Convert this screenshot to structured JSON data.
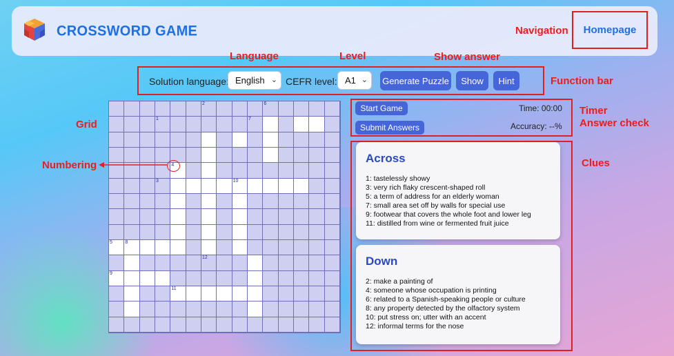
{
  "header": {
    "title": "CROSSWORD GAME",
    "home_link": "Homepage"
  },
  "annotations": {
    "navigation": "Navigation",
    "language": "Language",
    "level": "Level",
    "show_answer": "Show answer",
    "function_bar": "Function bar",
    "grid": "Grid",
    "numbering": "Numbering",
    "timer": "Timer",
    "answer_check": "Answer check",
    "clues": "Clues"
  },
  "function_bar": {
    "solution_language_label": "Solution language:",
    "solution_language_value": "English",
    "cefr_label": "CEFR level:",
    "cefr_value": "A1",
    "generate_button": "Generate Puzzle",
    "show_button": "Show",
    "hint_button": "Hint"
  },
  "game_controls": {
    "start_button": "Start Game",
    "submit_button": "Submit Answers",
    "time": "Time: 00:00",
    "accuracy": "Accuracy: --%"
  },
  "grid": {
    "rows": [
      "...............",
      "..........W.WW.",
      "......W.W.W....",
      "......W...W....",
      "....W.W........",
      "....WWWWWWWWW..",
      "....W.W.W......",
      "....W.W.W......",
      "....W.W.W......",
      "WWWWW.W.W......",
      ".W.......W.....",
      "WWWW.....W.....",
      ".W..WWWWWW.....",
      ".W.......W.....",
      "..............."
    ],
    "numbers": [
      {
        "r": 0,
        "c": 6,
        "n": "2"
      },
      {
        "r": 0,
        "c": 10,
        "n": "6"
      },
      {
        "r": 1,
        "c": 3,
        "n": "1"
      },
      {
        "r": 1,
        "c": 9,
        "n": "7"
      },
      {
        "r": 4,
        "c": 4,
        "n": "4"
      },
      {
        "r": 5,
        "c": 3,
        "n": "3"
      },
      {
        "r": 5,
        "c": 8,
        "n": "10"
      },
      {
        "r": 9,
        "c": 0,
        "n": "5"
      },
      {
        "r": 9,
        "c": 1,
        "n": "8"
      },
      {
        "r": 10,
        "c": 6,
        "n": "12"
      },
      {
        "r": 11,
        "c": 0,
        "n": "9"
      },
      {
        "r": 12,
        "c": 4,
        "n": "11"
      }
    ]
  },
  "clues": {
    "across_title": "Across",
    "across": [
      "1: tastelessly showy",
      "3: very rich flaky crescent-shaped roll",
      "5: a term of address for an elderly woman",
      "7: small area set off by walls for special use",
      "9: footwear that covers the whole foot and lower leg",
      "11: distilled from wine or fermented fruit juice"
    ],
    "down_title": "Down",
    "down": [
      "2: make a painting of",
      "4: someone whose occupation is printing",
      "6: related to a Spanish-speaking people or culture",
      "8: any property detected by the olfactory system",
      "10: put stress on; utter with an accent",
      "12: informal terms for the nose"
    ]
  },
  "colors": {
    "accent": "#4565d9",
    "annotation": "#ee1c1c",
    "title_blue": "#1f6fe5"
  }
}
